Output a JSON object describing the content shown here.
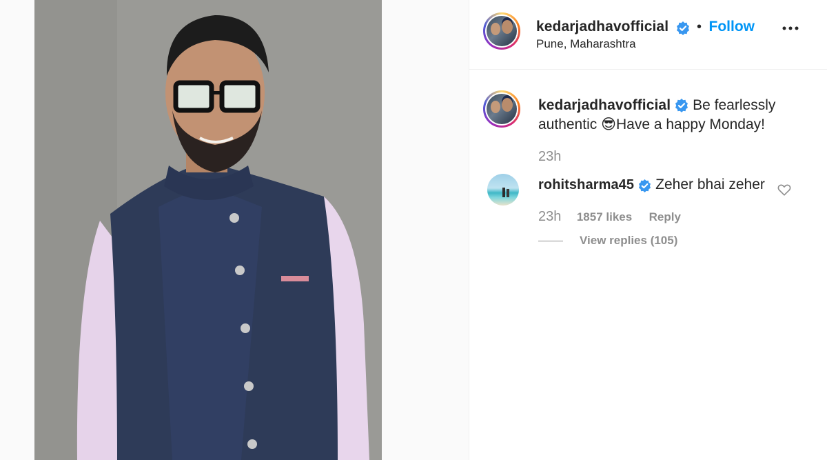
{
  "post": {
    "author": "kedarjadhavofficial",
    "location": "Pune, Maharashtra",
    "follow_label": "Follow",
    "separator": "•",
    "more_label": "•••"
  },
  "caption": {
    "author": "kedarjadhavofficial",
    "text_part1": "Be fearlessly",
    "text_part2": "authentic",
    "emoji": "😎",
    "text_part3": "Have a happy Monday!",
    "time": "23h"
  },
  "comments": [
    {
      "author": "rohitsharma45",
      "text": "Zeher bhai zeher",
      "time": "23h",
      "likes": "1857 likes",
      "reply_label": "Reply",
      "view_replies": "View replies (105)"
    }
  ],
  "colors": {
    "link_blue": "#0095f6",
    "verified_blue": "#3897f0",
    "muted": "#8e8e8e"
  },
  "icons": [
    "verified-badge-icon",
    "more-options-icon",
    "heart-icon"
  ]
}
